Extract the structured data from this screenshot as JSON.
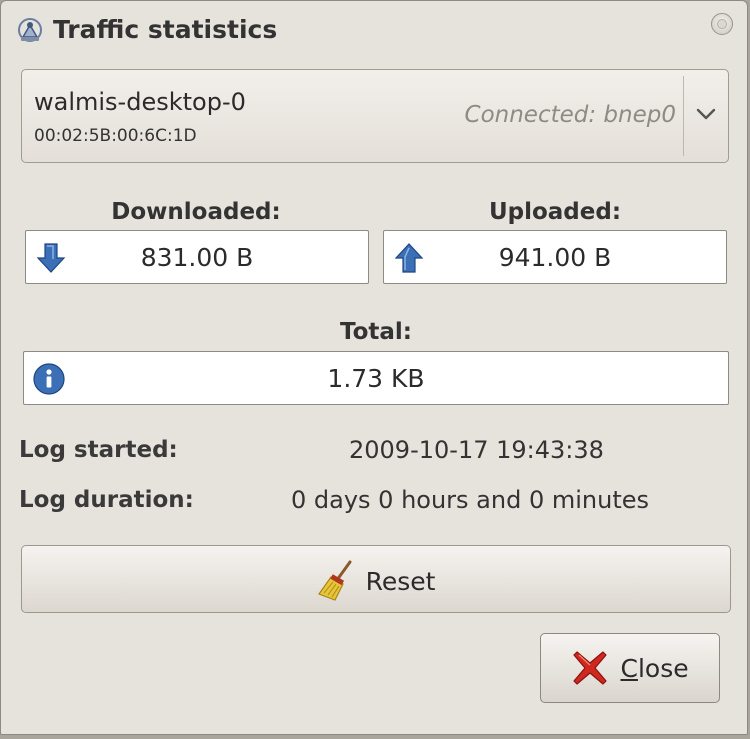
{
  "window": {
    "title": "Traffic statistics",
    "icon": "network-icon"
  },
  "device": {
    "name": "walmis-desktop-0",
    "mac": "00:02:5B:00:6C:1D",
    "status": "Connected: bnep0"
  },
  "downloaded": {
    "label": "Downloaded:",
    "value": "831.00 B",
    "icon": "arrow-down-icon"
  },
  "uploaded": {
    "label": "Uploaded:",
    "value": "941.00 B",
    "icon": "arrow-up-icon"
  },
  "total": {
    "label": "Total:",
    "value": "1.73 KB",
    "icon": "info-icon"
  },
  "log": {
    "started_label": "Log started:",
    "started_value": "2009-10-17 19:43:38",
    "duration_label": "Log duration:",
    "duration_value": "0 days 0 hours and 0 minutes"
  },
  "buttons": {
    "reset_label": "Reset",
    "close_mnemonic": "C",
    "close_rest": "lose"
  },
  "colors": {
    "accent_blue": "#3b6fb6",
    "close_red": "#d0281e",
    "window_bg": "#e6e2dc"
  }
}
